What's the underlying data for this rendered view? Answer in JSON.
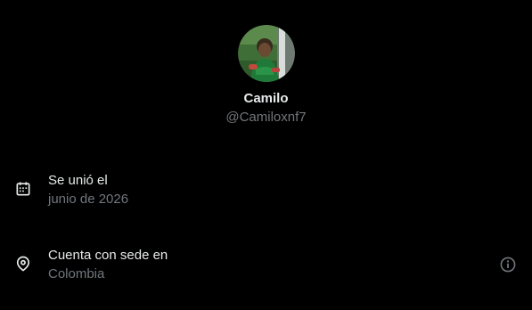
{
  "profile": {
    "display_name": "Camilo",
    "handle": "@Camiloxnf7"
  },
  "about": {
    "joined": {
      "icon": "calendar-icon",
      "title": "Se unió el",
      "value": "junio de 2026"
    },
    "location": {
      "icon": "location-pin-icon",
      "title": "Cuenta con sede en",
      "value": "Colombia",
      "info_icon": "info-icon"
    }
  },
  "colors": {
    "background": "#000000",
    "primary_text": "#e7e9ea",
    "secondary_text": "#71767b"
  }
}
